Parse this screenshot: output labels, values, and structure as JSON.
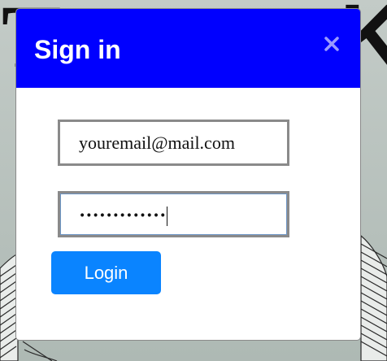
{
  "background": {
    "letter_left": "T",
    "letter_right": "K"
  },
  "modal": {
    "title": "Sign in",
    "close_symbol": "×",
    "close_icon": "close-icon",
    "header_color": "#0000ff",
    "email": {
      "value": "youremail@mail.com"
    },
    "password": {
      "masked_value": "•••••••••••••"
    },
    "login_label": "Login",
    "login_color": "#0a84ff"
  }
}
